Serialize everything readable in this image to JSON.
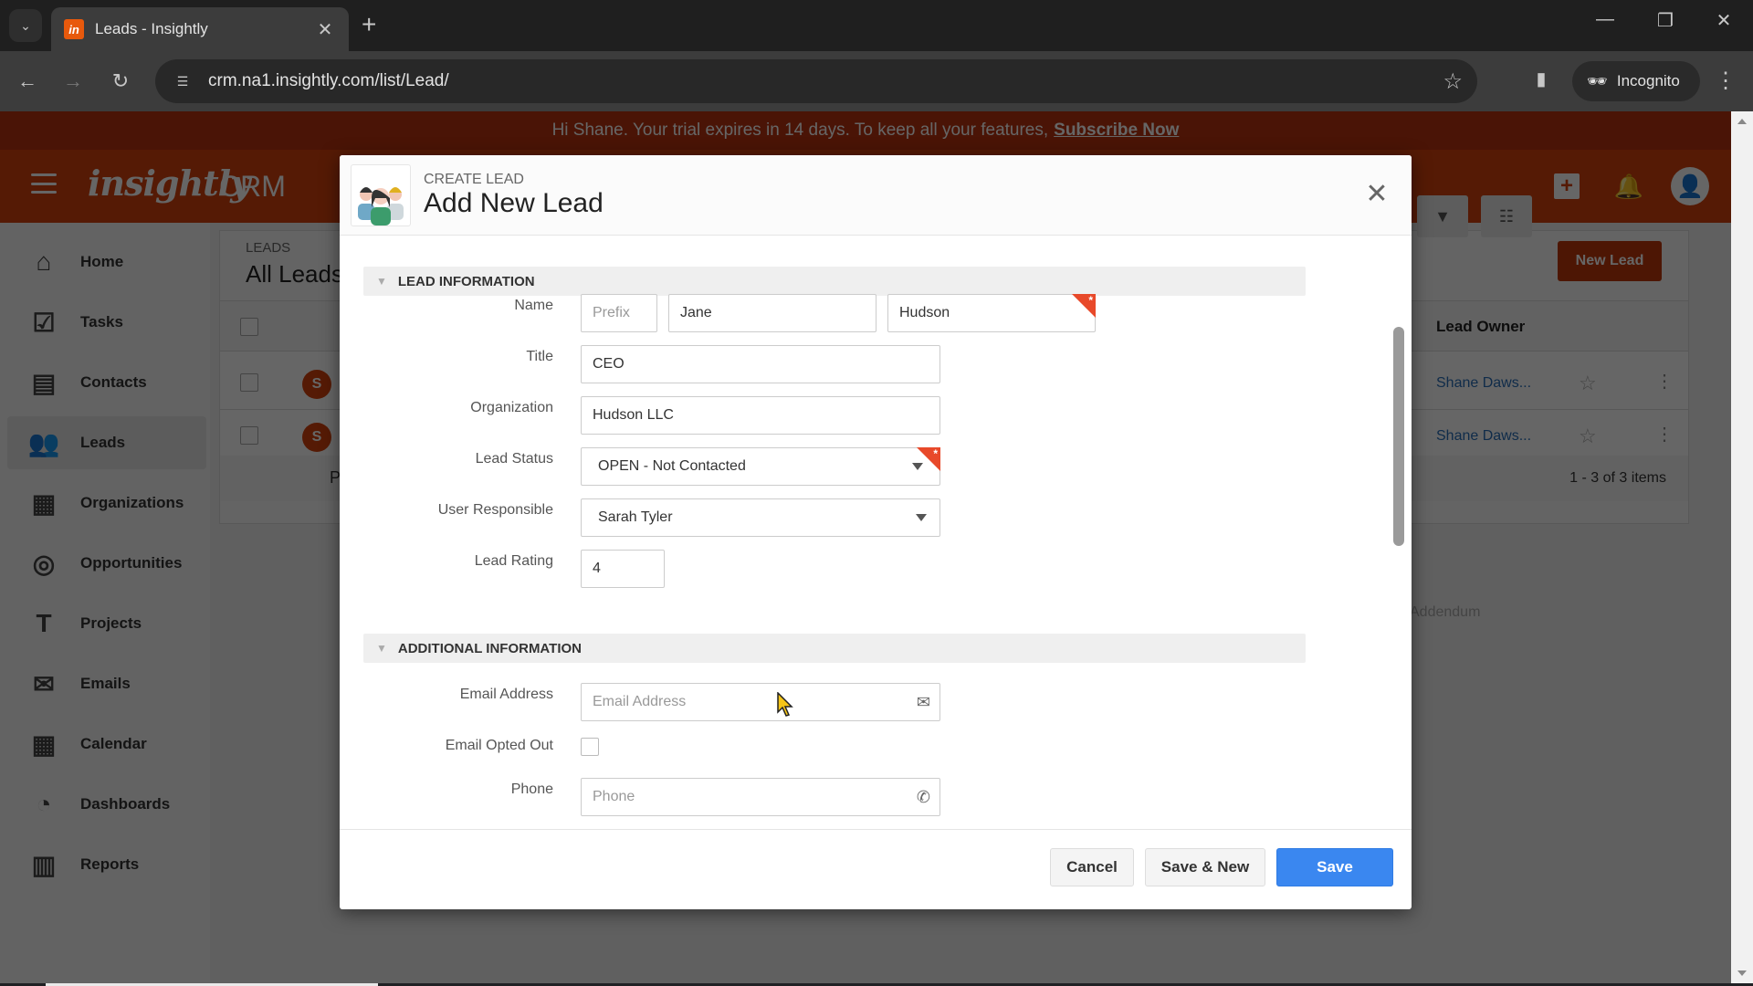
{
  "browser": {
    "tab_title": "Leads - Insightly",
    "favicon_letter": "in",
    "url": "crm.na1.insightly.com/list/Lead/",
    "incognito_label": "Incognito"
  },
  "trial_banner": {
    "message": "Hi Shane. Your trial expires in 14 days. To keep all your features,",
    "link": "Subscribe Now"
  },
  "appbar": {
    "logo": "insightly",
    "product": "CRM"
  },
  "sidebar": {
    "items": [
      {
        "label": "Home",
        "icon": "home-icon",
        "active": false
      },
      {
        "label": "Tasks",
        "icon": "tasks-icon",
        "active": false
      },
      {
        "label": "Contacts",
        "icon": "contacts-icon",
        "active": false
      },
      {
        "label": "Leads",
        "icon": "leads-icon",
        "active": true
      },
      {
        "label": "Organizations",
        "icon": "organizations-icon",
        "active": false
      },
      {
        "label": "Opportunities",
        "icon": "opportunities-icon",
        "active": false
      },
      {
        "label": "Projects",
        "icon": "projects-icon",
        "active": false
      },
      {
        "label": "Emails",
        "icon": "emails-icon",
        "active": false
      },
      {
        "label": "Calendar",
        "icon": "calendar-icon",
        "active": false
      },
      {
        "label": "Dashboards",
        "icon": "dashboards-icon",
        "active": false
      },
      {
        "label": "Reports",
        "icon": "reports-icon",
        "active": false
      }
    ]
  },
  "list": {
    "crumb": "LEADS",
    "title": "All Leads",
    "new_lead_label": "New Lead",
    "column_lead_owner": "Lead Owner",
    "rows": [
      {
        "avatar": "S",
        "owner": "Shane Daws..."
      },
      {
        "avatar": "S",
        "owner": "Shane Daws..."
      }
    ],
    "pager_partial": "P",
    "pager_count": "1 - 3 of 3 items",
    "addendum": "Addendum"
  },
  "modal": {
    "kicker": "CREATE LEAD",
    "title": "Add New Lead",
    "sections": {
      "lead_info": "LEAD INFORMATION",
      "additional_info": "ADDITIONAL INFORMATION"
    },
    "fields": {
      "name": {
        "label": "Name",
        "prefix_placeholder": "Prefix",
        "first": "Jane",
        "last": "Hudson"
      },
      "title": {
        "label": "Title",
        "value": "CEO"
      },
      "organization": {
        "label": "Organization",
        "value": "Hudson LLC"
      },
      "lead_status": {
        "label": "Lead Status",
        "value": "OPEN - Not Contacted"
      },
      "user_responsible": {
        "label": "User Responsible",
        "value": "Sarah Tyler"
      },
      "lead_rating": {
        "label": "Lead Rating",
        "value": "4"
      },
      "email": {
        "label": "Email Address",
        "placeholder": "Email Address"
      },
      "email_opted_out": {
        "label": "Email Opted Out",
        "checked": false
      },
      "phone": {
        "label": "Phone",
        "placeholder": "Phone"
      }
    },
    "buttons": {
      "cancel": "Cancel",
      "save_new": "Save & New",
      "save": "Save"
    }
  }
}
